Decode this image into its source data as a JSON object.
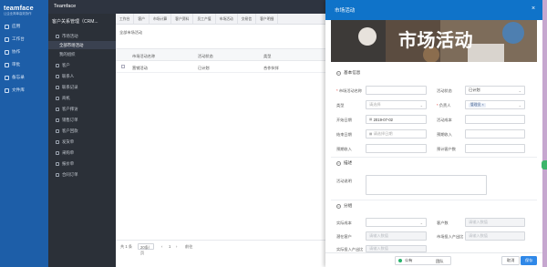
{
  "leftnav": {
    "logo": "teamface",
    "subtitle": "让企业简单高效协作",
    "items": [
      {
        "label": "应用",
        "icon": "apps-icon"
      },
      {
        "label": "工作台",
        "icon": "workbench-icon"
      },
      {
        "label": "协作",
        "icon": "collaborate-icon"
      },
      {
        "label": "审批",
        "icon": "approval-icon"
      },
      {
        "label": "备忘录",
        "icon": "memo-icon"
      },
      {
        "label": "文件库",
        "icon": "folder-icon"
      }
    ]
  },
  "topbar": {
    "title": "Teamface"
  },
  "sidebar": {
    "title": "客户关系管理（CRM...",
    "items": [
      {
        "label": "市场活动",
        "indent": false,
        "active": false
      },
      {
        "label": "全部市场活动",
        "indent": true,
        "active": true
      },
      {
        "label": "我的组织",
        "indent": true,
        "active": false
      },
      {
        "label": "客户",
        "indent": false,
        "active": false
      },
      {
        "label": "联系人",
        "indent": false,
        "active": false
      },
      {
        "label": "联系记录",
        "indent": false,
        "active": false
      },
      {
        "label": "商机",
        "indent": false,
        "active": false
      },
      {
        "label": "客户拜访",
        "indent": false,
        "active": false
      },
      {
        "label": "销售订单",
        "indent": false,
        "active": false
      },
      {
        "label": "客户回款",
        "indent": false,
        "active": false
      },
      {
        "label": "发货单",
        "indent": false,
        "active": false
      },
      {
        "label": "采购单",
        "indent": false,
        "active": false
      },
      {
        "label": "报价单",
        "indent": false,
        "active": false
      },
      {
        "label": "合同订单",
        "indent": false,
        "active": false
      }
    ]
  },
  "main": {
    "tabs": [
      "工作台",
      "客户",
      "市场计算",
      "客户资料",
      "员工产值",
      "市场活动",
      "交易信",
      "客户明细"
    ],
    "breadcrumb": "全部市场活动",
    "columns": [
      "市场活动名称",
      "活动状态",
      "类型"
    ],
    "rows": [
      {
        "name": "营销活动",
        "status": "已计划",
        "type": "合作伙伴"
      }
    ],
    "footer": {
      "total": "共 1 条",
      "page_size": "20条/页",
      "page": "1",
      "goto": "前往"
    }
  },
  "modal": {
    "title": "市场活动",
    "banner_text": "市场活动",
    "sections": {
      "basic": "基本信息",
      "desc": "描述",
      "share": "分组"
    },
    "fields": {
      "name_label": "市场活动名称",
      "status_label": "活动状态",
      "status_value": "已计划",
      "type_label": "类型",
      "type_placeholder": "请选择",
      "owner_label": "负责人",
      "owner_value": "管理员",
      "start_label": "开始日期",
      "start_value": "2019-07-02",
      "end_label": "结束日期",
      "end_placeholder": "请选择日期",
      "response_label": "活动成本",
      "budget_label": "预期收入",
      "expected_label": "预计客户数",
      "desc_label": "活动说明",
      "actual_cost_label": "实际成本",
      "customer_count_label": "客户数",
      "customer_count_placeholder": "请输入数值",
      "leads_label": "潜在客户",
      "leads_placeholder": "请输入数值",
      "leads_conv_label": "市场投入产出比",
      "leads_conv_placeholder": "请输入数值",
      "extra_label": "实际投入产出比",
      "extra_placeholder": "请输入数值"
    },
    "footer": {
      "visibility": "公有",
      "team": "团队",
      "cancel": "取消",
      "save": "保存"
    }
  },
  "colors": {
    "nav_blue": "#1d5ea8",
    "modal_header": "#0f73c9",
    "save_button": "#2f88e8",
    "required": "#e3413b",
    "online_dot": "#27b36b"
  }
}
